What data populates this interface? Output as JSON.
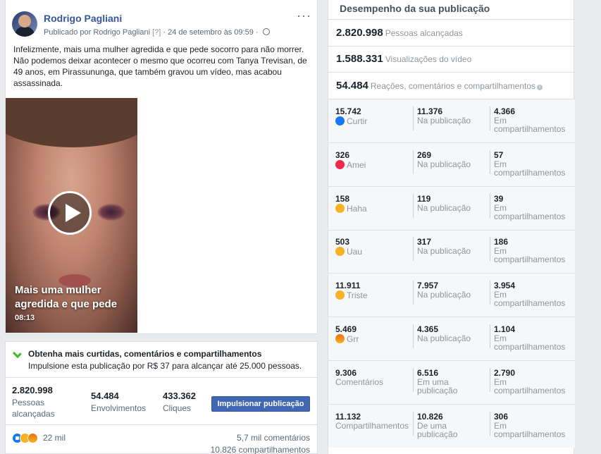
{
  "post": {
    "author": "Rodrigo Pagliani",
    "meta_prefix": "Publicado por Rodrigo Pagliani",
    "meta_q": "[?]",
    "meta_date": " · 24 de setembro às 09:59 · ",
    "more": "···",
    "text": "Infelizmente, mais uma mulher agredida e que pede socorro para não morrer. Não podemos deixar acontecer o mesmo que ocorreu com Tanya Trevisan, de 49 anos, em Pirassununga, que também gravou um vídeo, mas acabou assassinada.",
    "video_title": "Mais uma mulher agredida e que pede",
    "video_time": "08:13"
  },
  "promo": {
    "title": "Obtenha mais curtidas, comentários e compartilhamentos",
    "subtitle": "Impulsione esta publicação por R$ 37 para alcançar até 25.000 pessoas.",
    "kpis": [
      {
        "value": "2.820.998",
        "label1": "Pessoas",
        "label2": "alcançadas"
      },
      {
        "value": "54.484",
        "label1": "Envolvimentos",
        "label2": ""
      },
      {
        "value": "433.362",
        "label1": "Cliques",
        "label2": ""
      }
    ],
    "boost_label": "Impulsionar publicação",
    "reactions_count": "22 mil",
    "comments": "5,7 mil comentários",
    "shares": "10.826 compartilhamentos"
  },
  "performance": {
    "title": "Desempenho da sua publicação",
    "reach_value": "2.820.998",
    "reach_label": "Pessoas alcançadas",
    "views_value": "1.588.331",
    "views_label": "Visualizações do vídeo",
    "eng_value": "54.484",
    "eng_label": "Reações, comentários e compartilhamentos",
    "rows": [
      {
        "total": "15.742",
        "name": "Curtir",
        "icon": "like-icon",
        "on_post": "11.376",
        "on_post_l1": "Na publicação",
        "on_post_l2": "",
        "shares": "4.366",
        "shares_l1": "Em",
        "shares_l2": "compartilhamentos"
      },
      {
        "total": "326",
        "name": "Amei",
        "icon": "love-icon",
        "on_post": "269",
        "on_post_l1": "Na publicação",
        "on_post_l2": "",
        "shares": "57",
        "shares_l1": "Em",
        "shares_l2": "compartilhamentos"
      },
      {
        "total": "158",
        "name": "Haha",
        "icon": "haha-icon",
        "on_post": "119",
        "on_post_l1": "Na publicação",
        "on_post_l2": "",
        "shares": "39",
        "shares_l1": "Em",
        "shares_l2": "compartilhamentos"
      },
      {
        "total": "503",
        "name": "Uau",
        "icon": "wow-icon",
        "on_post": "317",
        "on_post_l1": "Na publicação",
        "on_post_l2": "",
        "shares": "186",
        "shares_l1": "Em",
        "shares_l2": "compartilhamentos"
      },
      {
        "total": "11.911",
        "name": "Triste",
        "icon": "sad-icon",
        "on_post": "7.957",
        "on_post_l1": "Na publicação",
        "on_post_l2": "",
        "shares": "3.954",
        "shares_l1": "Em",
        "shares_l2": "compartilhamentos"
      },
      {
        "total": "5.469",
        "name": "Grr",
        "icon": "angry-icon",
        "on_post": "4.365",
        "on_post_l1": "Na publicação",
        "on_post_l2": "",
        "shares": "1.104",
        "shares_l1": "Em",
        "shares_l2": "compartilhamentos"
      },
      {
        "total": "9.306",
        "name": "Comentários",
        "icon": "",
        "on_post": "6.516",
        "on_post_l1": "Em uma",
        "on_post_l2": "publicação",
        "shares": "2.790",
        "shares_l1": "Em",
        "shares_l2": "compartilhamentos"
      },
      {
        "total": "11.132",
        "name": "Compartilhamentos",
        "icon": "",
        "on_post": "10.826",
        "on_post_l1": "De uma",
        "on_post_l2": "publicação",
        "shares": "306",
        "shares_l1": "Em",
        "shares_l2": "compartilhamentos"
      }
    ]
  }
}
